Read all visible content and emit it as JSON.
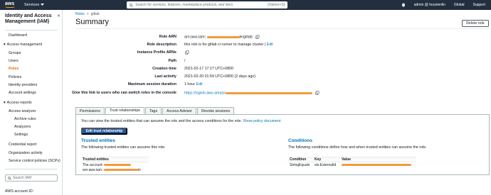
{
  "topnav": {
    "logo": "aws",
    "services": "Services",
    "search_placeholder": "Search for services, features, marketplace products, and docs",
    "search_hint": "[Option+S]",
    "user": "admin @ hounienlin",
    "region": "Global",
    "support": "Support"
  },
  "sidebar": {
    "title": "Identity and Access Management (IAM)",
    "dashboard": "Dashboard",
    "access_management": "Access management",
    "groups": "Groups",
    "users": "Users",
    "roles": "Roles",
    "policies": "Policies",
    "identity_providers": "Identity providers",
    "account_settings": "Account settings",
    "access_reports": "Access reports",
    "access_analyzer": "Access analyzer",
    "archive_rules": "Archive rules",
    "analyzers": "Analyzers",
    "settings": "Settings",
    "credential_report": "Credential report",
    "organization_activity": "Organization activity",
    "scps": "Service control policies (SCPs)",
    "search_placeholder": "Search IAM",
    "account_id_label": "AWS account ID:"
  },
  "breadcrumb": {
    "roles": "Roles",
    "sep": ">",
    "current": "gitlab"
  },
  "page_title": "Summary",
  "delete_role": "Delete role",
  "summary": {
    "role_arn_label": "Role ARN",
    "role_arn_prefix": "arn:aws:iam::",
    "role_arn_suffix": "le/gitlab",
    "role_description_label": "Role description",
    "role_description": "this role is for gitlab ci runner to manage cluster",
    "role_description_sep": "|",
    "role_description_edit": "Edit",
    "instance_profile_label": "Instance Profile ARNs",
    "path_label": "Path",
    "path": "/",
    "creation_time_label": "Creation time",
    "creation_time": "2021-02-17 17:17 UTC+0800",
    "last_activity_label": "Last activity",
    "last_activity": "2021-02-20 01:59 UTC+0800 (2 days ago)",
    "max_session_label": "Maximum session duration",
    "max_session": "1 hour",
    "max_session_edit": "Edit",
    "switch_link_label": "Give this link to users who can switch roles in the console",
    "switch_link": "https://signin.aws.amazo"
  },
  "tabs": [
    "Permissions",
    "Trust relationships",
    "Tags",
    "Access Advisor",
    "Revoke sessions"
  ],
  "trust": {
    "description": "You can view the trusted entities that can assume the role and the access conditions for the role.",
    "show_policy": "Show policy document",
    "edit_button": "Edit trust relationship",
    "trusted_entities_title": "Trusted entities",
    "trusted_entities_desc": "The following trusted entities can assume this role.",
    "trusted_entities_header": "Trusted entities",
    "entity_account_prefix": "The account:",
    "entity_arn_prefix": "arn:aws:iam::",
    "entity_arn_suffix": "in",
    "conditions_title": "Conditions",
    "conditions_desc": "The following conditions define how and when trusted entities can assume the role.",
    "condition_headers": [
      "Condition",
      "Key",
      "Value"
    ],
    "condition_row": [
      "StringEquals",
      "sts:ExternalId"
    ]
  },
  "colors": {
    "nav": "#232f3e",
    "accent": "#ec7211",
    "link": "#0073bb",
    "primary_button": "#1d5ba6",
    "redaction": "#f29b3c"
  }
}
